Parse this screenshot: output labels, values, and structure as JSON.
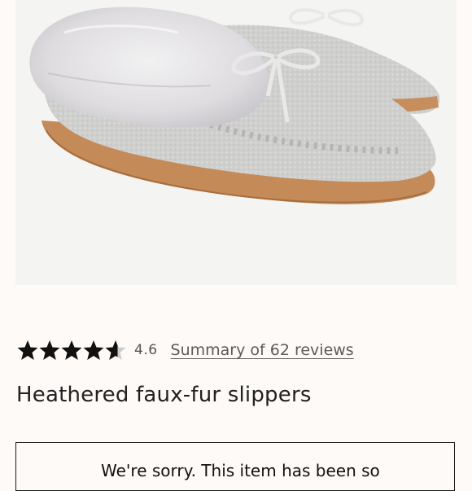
{
  "product": {
    "image_alt": "Heathered faux-fur slippers",
    "title": "Heathered faux-fur slippers"
  },
  "rating": {
    "value": "4.6",
    "stars_filled_fraction": 0.92,
    "review_link_label": "Summary of 62 reviews",
    "star_color": "#111111",
    "star_empty_color": "#cccccc"
  },
  "notice": {
    "text": "We're sorry. This item has been so"
  }
}
